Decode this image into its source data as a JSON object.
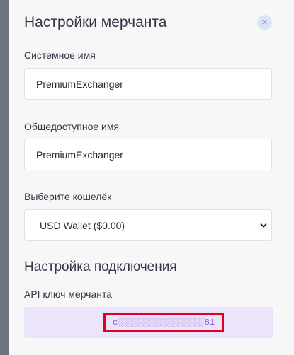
{
  "dialog": {
    "title": "Настройки мерчанта",
    "close_label": "×"
  },
  "system_name": {
    "label": "Системное имя",
    "value": "PremiumExchanger"
  },
  "public_name": {
    "label": "Общедоступное имя",
    "value": "PremiumExchanger"
  },
  "wallet": {
    "label": "Выберите кошелёк",
    "selected": "USD Wallet ($0.00)"
  },
  "connection": {
    "section_title": "Настройка подключения",
    "api_key_label": "API ключ мерчанта",
    "api_key_value": "c░░░░░░░░░░░░░░░░░81"
  },
  "colors": {
    "backdrop": "#6e7381",
    "panel": "#f7f7f8",
    "api_box": "#ebe4fb",
    "api_key_text": "#7f58d8",
    "highlight_border": "#e4001c",
    "close_button": "#dde4f1"
  }
}
